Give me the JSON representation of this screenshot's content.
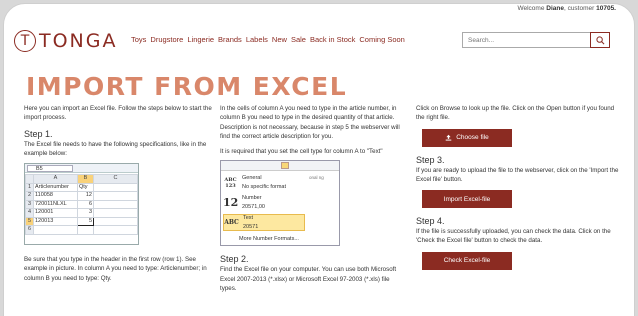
{
  "welcome": {
    "prefix": "Welcome ",
    "name": "Diane",
    "middle": ", customer ",
    "id": "10705."
  },
  "logo": {
    "letter": "T",
    "name": "TONGA"
  },
  "nav": [
    "Toys",
    "Drugstore",
    "Lingerie",
    "Brands",
    "Labels",
    "New",
    "Sale",
    "Back in Stock",
    "Coming Soon"
  ],
  "search": {
    "placeholder": "Search..."
  },
  "page_title": "IMPORT FROM EXCEL",
  "col1": {
    "intro": "Here you can import an Excel file. Follow the steps below to start the import process.",
    "step1_title": "Step 1.",
    "step1_text": "The Excel file needs to have the following specifications, like in the example below:",
    "footer": "Be sure that you type in the header in the first row (row 1). See example in picture. In column A you need to type: Articlenumber; in column B you need to type: Qty."
  },
  "excel": {
    "namebox": "B5",
    "col_headers": [
      "",
      "A",
      "B",
      "C"
    ],
    "rows": [
      [
        "1",
        "Articlenumber",
        "Qty",
        ""
      ],
      [
        "2",
        "110058",
        "12",
        ""
      ],
      [
        "3",
        "720011NLXL",
        "6",
        ""
      ],
      [
        "4",
        "120001",
        "3",
        ""
      ],
      [
        "5",
        "120013",
        "5",
        ""
      ],
      [
        "6",
        "",
        "",
        ""
      ]
    ]
  },
  "col2": {
    "intro": "In the cells of column A you need to type in the article number, in column B you need to type in the desired quantity of that article. Description is not necessary, because in step 5 the webserver will find the correct article description for you.",
    "required": "It is required that you set the cell type for column A to \"Text\"",
    "step2_title": "Step 2.",
    "step2_text": "Find the Excel file on your computer. You can use both Microsoft Excel 2007-2013 (*.xlsx) or Microsoft Excel 97-2003 (*.xls) file types."
  },
  "format_menu": {
    "items": [
      {
        "icon": "ABC 123",
        "label": "General",
        "sub": "No specific format"
      },
      {
        "icon": "12",
        "label": "Number",
        "sub": "20571,00"
      },
      {
        "icon": "ABC",
        "label": "Text",
        "sub": "20571"
      }
    ],
    "more": "More Number Formats...",
    "side": "onal ng"
  },
  "col3": {
    "intro": "Click on Browse to look up the file. Click on the Open button if you found the right file.",
    "choose_label": "Choose file",
    "step3_title": "Step 3.",
    "step3_text": "If you are ready to upload the file to the webserver, click on the 'Import the Excel file' button.",
    "import_label": "Import Excel-file",
    "step4_title": "Step 4.",
    "step4_text": "If the file is successfully uploaded, you can check the data. Click on the 'Check the Excel file' button to check the data.",
    "check_label": "Check Excel-file"
  },
  "colors": {
    "brand": "#8b2b22",
    "title": "#d9876a"
  }
}
